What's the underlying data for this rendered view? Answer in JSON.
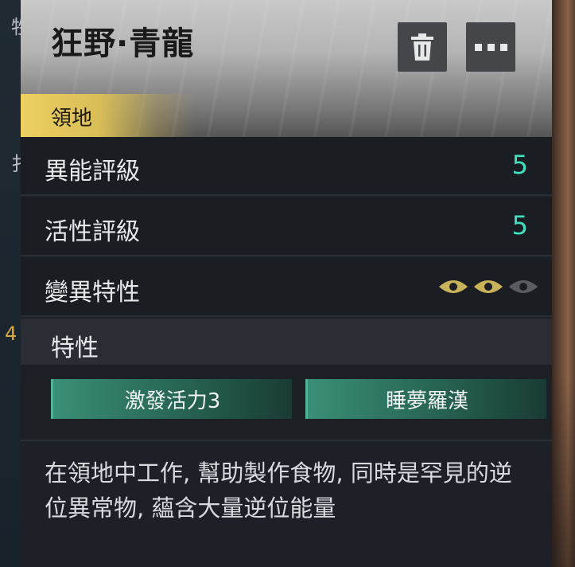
{
  "background": {
    "left_fragment_top": "牲",
    "left_fragment_mid": "扌",
    "left_number": "4"
  },
  "panel": {
    "title": "狂野·青龍",
    "tag": "領地",
    "buttons": {
      "delete_icon": "trash-icon",
      "more_icon": "more-icon"
    },
    "stats": [
      {
        "label": "異能評級",
        "value": "5"
      },
      {
        "label": "活性評級",
        "value": "5"
      }
    ],
    "mutation": {
      "label": "變異特性",
      "level": 2,
      "max": 3,
      "active_color": "#c8b25a",
      "inactive_color": "#5a5d60"
    },
    "traits_header": "特性",
    "traits": [
      "激發活力3",
      "睡夢羅漢"
    ],
    "description": "在領地中工作, 幫助製作食物, 同時是罕見的逆位異常物, 蘊含大量逆位能量",
    "accent_value_color": "#3fe0c0",
    "tag_color": "#ecd062"
  }
}
